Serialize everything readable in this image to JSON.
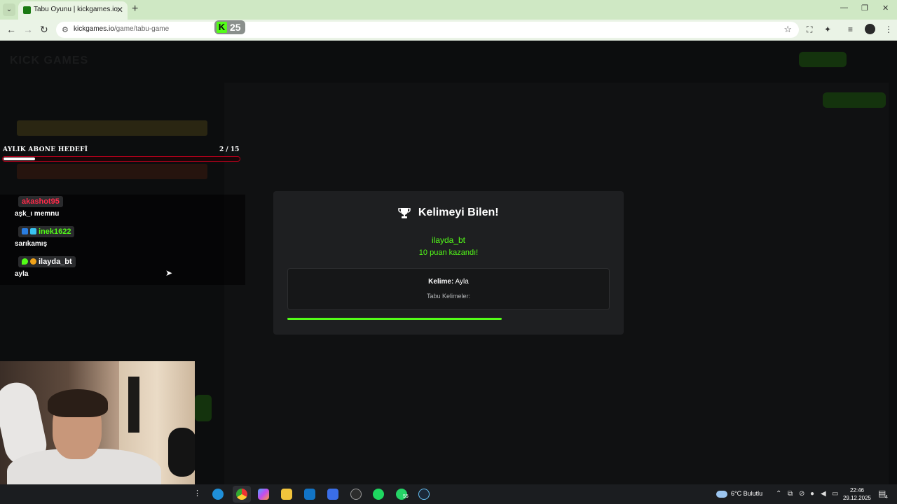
{
  "browser": {
    "tab_title": "Tabu Oyunu | kickgames.io",
    "url_host": "kickgames.io",
    "url_path": "/game/tabu-game",
    "kick_badge_count": "25"
  },
  "overlay": {
    "goal_label": "AYLIK ABONE HEDEFİ",
    "goal_count": "2 / 15",
    "goal_progress": 0.133,
    "chat": [
      {
        "user": "akashot95",
        "color": "#ff2b4a",
        "text": "aşk_ı memnu"
      },
      {
        "user": "inek1622",
        "color": "#53fc18",
        "text": "sarıkamış"
      },
      {
        "user": "ilayda_bt",
        "color": "#ffffff",
        "text": "ayla"
      }
    ]
  },
  "modal": {
    "title": "Kelimeyi Bilen!",
    "winner": "ilayda_bt",
    "points_text": "10 puan kazandı!",
    "word_label": "Kelime:",
    "word_value": "Ayla",
    "taboo_label": "Tabu Kelimeler:",
    "timer_progress": 0.665
  },
  "taskbar": {
    "weather": "6°C  Bulutlu",
    "time": "22:46",
    "date": "29.12.2025",
    "whatsapp_badge": "55",
    "notification_count": "4"
  },
  "colors": {
    "kick_green": "#53fc18",
    "goal_bar_border": "#b3001b"
  }
}
